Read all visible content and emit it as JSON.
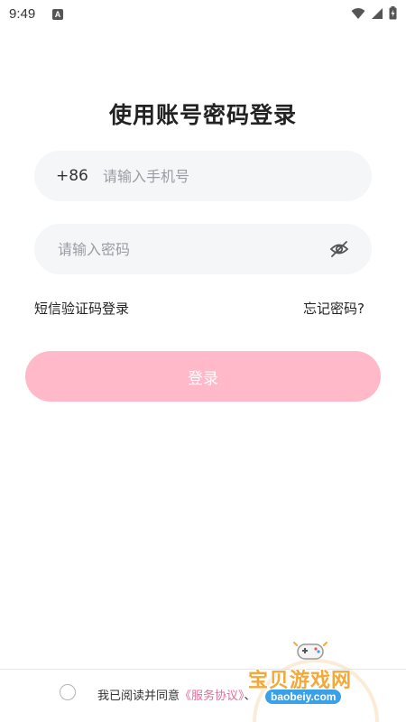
{
  "status_bar": {
    "time": "9:49",
    "notification_letter": "A"
  },
  "login": {
    "title": "使用账号密码登录",
    "phone": {
      "country_code": "+86",
      "placeholder": "请输入手机号"
    },
    "password": {
      "placeholder": "请输入密码"
    },
    "sms_login_link": "短信验证码登录",
    "forgot_password_link": "忘记密码?",
    "login_button": "登录"
  },
  "agreement": {
    "prefix": "我已阅读并同意",
    "service_agreement": "《服务协议》",
    "separator": "、"
  },
  "watermark": {
    "name": "宝贝游戏网",
    "domain": "baobeiy.com"
  },
  "colors": {
    "accent_pink": "#ffb9c9",
    "link_pink": "#e86b9a",
    "field_bg": "#f5f6f8"
  }
}
